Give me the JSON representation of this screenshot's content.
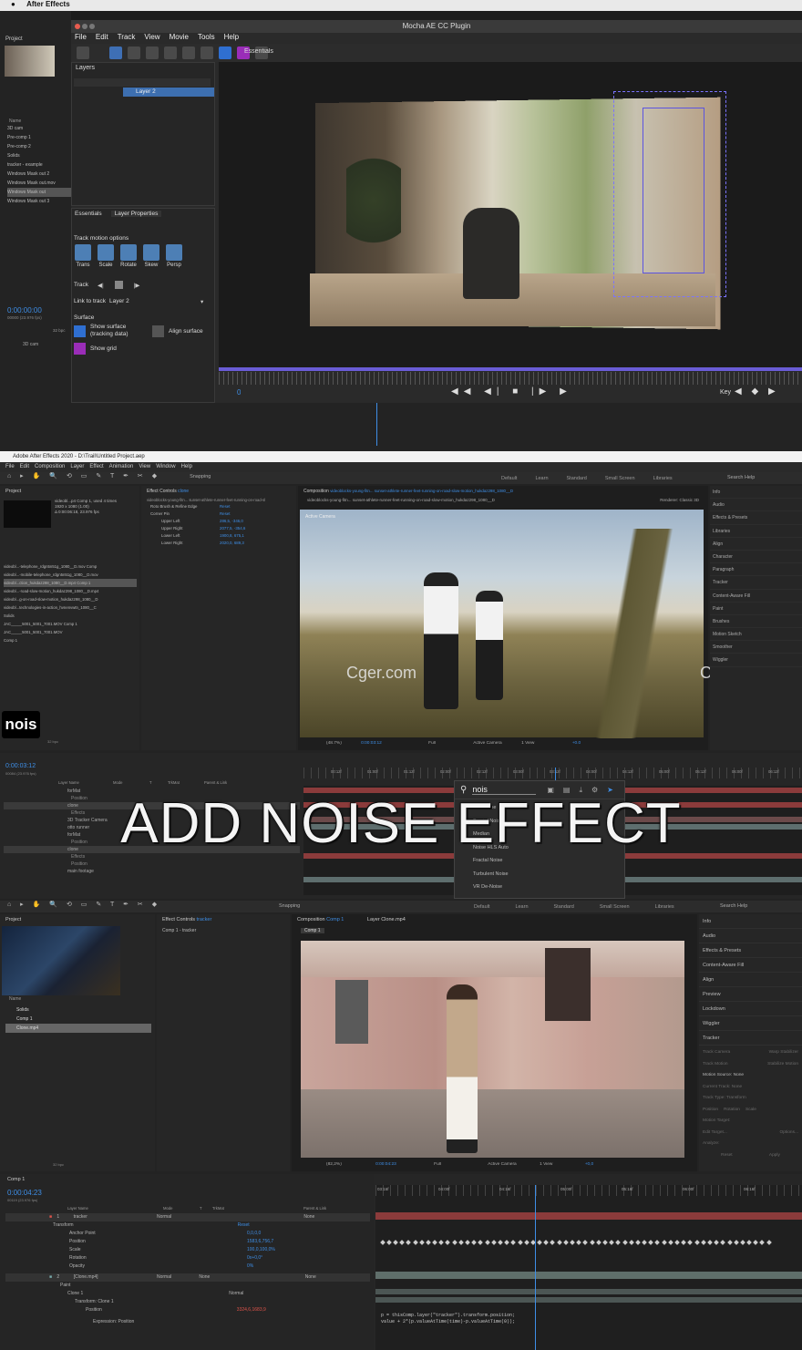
{
  "mac": {
    "app_name": "After Effects"
  },
  "mocha": {
    "window_title": "Mocha AE CC Plugin",
    "menu": [
      "File",
      "Edit",
      "Track",
      "View",
      "Movie",
      "Tools",
      "Help"
    ],
    "workspace": "Essentials",
    "layers_panel_title": "Layers",
    "layer_name": "Layer 2",
    "tabs": [
      "Essentials",
      "Layer Properties"
    ],
    "track_motion_options": "Track motion options",
    "motion_buttons": [
      "Trans",
      "Scale",
      "Rotate",
      "Skew",
      "Persp"
    ],
    "track_label": "Track",
    "link_to_track_label": "Link to track",
    "link_to_track_value": "Layer 2",
    "surface_label": "Surface",
    "show_surface": "Show surface (tracking data)",
    "align_surface": "Align surface",
    "show_grid": "Show grid",
    "frame_value": "0",
    "key_label": "Key"
  },
  "ae_left_panel": {
    "project_tab": "Project",
    "items": [
      "3D cam",
      "Pre-comp 1",
      "Pre-comp 2",
      "Solids",
      "tracker - example",
      "Windows Mask out 2",
      "Windows Mask out.mov",
      "Windows Mask out",
      "Windows Mask out 3"
    ],
    "name_header": "Name",
    "time": "0:00:00:00",
    "fps": "00000 (23.976 fps)",
    "bpc": "32 bpc",
    "layer_3d_cam": "3D cam"
  },
  "ae2": {
    "title": "Adobe After Effects 2020 - D:\\Trail\\Untitled Project.aep",
    "menu": [
      "File",
      "Edit",
      "Composition",
      "Layer",
      "Effect",
      "Animation",
      "View",
      "Window",
      "Help"
    ],
    "snapping": "Snapping",
    "workspaces": [
      "Default",
      "Learn",
      "Standard",
      "Small Screen",
      "Libraries"
    ],
    "search_help": "Search Help",
    "project_tab": "Project",
    "project_item_info": "videobl...p4 Comp 1, used 4 times",
    "project_item_size": "1920 x 1080 (1.00)",
    "project_item_duration": "Δ 0:00:06:18, 23.976 fps",
    "project_items": [
      "videobl...-telephone_rdgn5n51g_1080__D.mov Comp",
      "videobl...-mobile-telephone_rdgn5n51g_1080__D.mov",
      "videobl...ction_hukdaz298_1080__D.mp4 Comp 1",
      "videobl...-road-slow-motion_hukdaz298_1080__D.mp4",
      "videobl...g-on-road-slow-motion_hukdaz298_1080__D",
      "videobl...technologies-in-action_hvnenvwtn_1080__C",
      "Solids",
      "JAC_____5001_5001_7001.MOV Comp 1",
      "JAC_____5001_5001_7001.MOV",
      "Comp 1"
    ],
    "effect_controls_tab": "Effect Controls",
    "effect_controls_layer": "clone",
    "ec_header": "videoblocks-young-fitn... sunset-athlete-runner-feet-running-on-road-sl",
    "effects": [
      {
        "name": "Roto Brush & Refine Edge",
        "value": "Reset"
      },
      {
        "name": "Corner Pin",
        "value": "Reset"
      },
      {
        "name": "Upper Left",
        "value": "286,5, -346,0"
      },
      {
        "name": "Upper Right",
        "value": "2077,5, -354,6"
      },
      {
        "name": "Lower Left",
        "value": "1900,8, 675,1"
      },
      {
        "name": "Lower Right",
        "value": "2020,0, 689,3"
      }
    ],
    "comp_tab": "Composition",
    "comp_name": "videoblocks-young-fitn... sunset-athlete-runner-feet-running-on-road-slow-motion_hukdaz298_1080__D",
    "renderer": "Renderer:",
    "renderer_value": "Classic 3D",
    "active_camera": "Active Camera",
    "zoom": "(48.7%)",
    "timecode": "0:00:03:12",
    "resolution": "Full",
    "view": "1 View",
    "exposure": "+0.0",
    "watermark": "Cger.com",
    "right_panel": [
      "Info",
      "Audio",
      "Effects & Presets",
      "Libraries",
      "Align",
      "Character",
      "Paragraph",
      "Tracker",
      "Content-Aware Fill",
      "Paint",
      "Brushes",
      "Motion Sketch",
      "Smoother",
      "Wiggler"
    ],
    "timeline_time": "0:00:03:12",
    "timeline_fps": "00084 (23.976 fps)",
    "timeline_columns": [
      "Layer Name",
      "Mode",
      "T",
      "TrkMat",
      "Parent & Link"
    ],
    "timeline_layers": [
      "forMat",
      "Position",
      "clone",
      "Effects",
      "3D Tracker Camera",
      "otto runner",
      "forMat",
      "Position",
      "clone",
      "Effects",
      "Position",
      "main footage"
    ],
    "ruler": [
      "00:12f",
      "01:00f",
      "01:12f",
      "02:00f",
      "02:12f",
      "03:00f",
      "03:12f",
      "04:00f",
      "04:12f",
      "05:00f",
      "05:12f",
      "06:00f",
      "06:12f"
    ],
    "search_query": "nois",
    "search_results": [
      "Add Noise",
      "Fractal Noise",
      "Median",
      "Noise HLS Auto",
      "Fractal Noise",
      "Turbulent Noise",
      "VR De-Noise"
    ],
    "overlay_title": "ADD NOISE EFFECT",
    "nois_badge": "nois",
    "bpc": "32 bpc"
  },
  "ae3": {
    "snapping": "Snapping",
    "workspaces": [
      "Default",
      "Learn",
      "Standard",
      "Small Screen",
      "Libraries"
    ],
    "search_help": "Search Help",
    "project_tab": "Project",
    "effect_controls_tab": "Effect Controls",
    "effect_controls_layer": "tracker",
    "ec_subtitle": "Comp 1 - tracker",
    "comp_tab": "Composition",
    "comp_name": "Comp 1",
    "layer_tab": "Layer",
    "layer_tab_name": "Clone.mp4",
    "comp_subtab": "Comp 1",
    "project_items": [
      "Solids",
      "Comp 1",
      "Clone.mp4"
    ],
    "name_header": "Name",
    "zoom": "(82,2%)",
    "timecode": "0:00:04:23",
    "resolution": "Full",
    "active_camera": "Active Camera",
    "view": "1 View",
    "exposure": "+0,0",
    "right_panel": [
      "Info",
      "Audio",
      "Effects & Presets",
      "Content-Aware Fill",
      "Align",
      "Preview",
      "Lockdown",
      "Wiggler",
      "Tracker"
    ],
    "tracker": {
      "buttons": [
        "Track Camera",
        "Warp Stabilizer",
        "Track Motion",
        "Stabilize Motion"
      ],
      "motion_source": "Motion Source:",
      "motion_source_value": "None",
      "current_track": "Current Track:",
      "current_track_value": "None",
      "track_type": "Track Type:",
      "track_type_value": "Transform",
      "checks": [
        "Position",
        "Rotation",
        "Scale"
      ],
      "motion_target": "Motion Target:",
      "edit_target": "Edit Target...",
      "options": "Options...",
      "analyze": "Analyze:",
      "reset": "Reset",
      "apply": "Apply"
    },
    "timeline_tab": "Comp 1",
    "timeline_time": "0:00:04:23",
    "timeline_fps": "00119 (23.976 fps)",
    "columns": [
      "Layer Name",
      "Mode",
      "T",
      "TrkMat",
      "Parent & Link"
    ],
    "layer1": {
      "num": "1",
      "name": "tracker",
      "mode": "Normal",
      "parent": "None"
    },
    "transform": "Transform",
    "transform_reset": "Reset",
    "props": [
      {
        "name": "Anchor Point",
        "value": "0,0,0,0"
      },
      {
        "name": "Position",
        "value": "1583,6,756,7"
      },
      {
        "name": "Scale",
        "value": "100,0,100,0%"
      },
      {
        "name": "Rotation",
        "value": "0x+0,0°"
      },
      {
        "name": "Opacity",
        "value": "0%"
      }
    ],
    "layer2": {
      "num": "2",
      "name": "[Clone.mp4]",
      "mode": "Normal",
      "trkmat": "None",
      "parent": "None"
    },
    "paint": "Paint",
    "clone1": "Clone 1",
    "clone1_mode": "Normal",
    "transform_clone": "Transform: Clone 1",
    "position_label": "Position",
    "position_value": "3324,6,1683,9",
    "expression_label": "Expression: Position",
    "expression": [
      "p = thisComp.layer(\"tracker\").transform.position;",
      "value + 2*(p.valueAtTime(time)-p.valueAtTime(0));"
    ],
    "ruler": [
      "03:16f",
      "04:00f",
      "04:16f",
      "05:00f",
      "05:16f",
      "06:00f",
      "06:16f"
    ],
    "bpc": "32 bpc"
  },
  "colors": {
    "panel_bg": "#262626",
    "accent_blue": "#3e8ee6",
    "accent_red": "#e0544b",
    "mocha_purple": "#6a5cd6"
  }
}
